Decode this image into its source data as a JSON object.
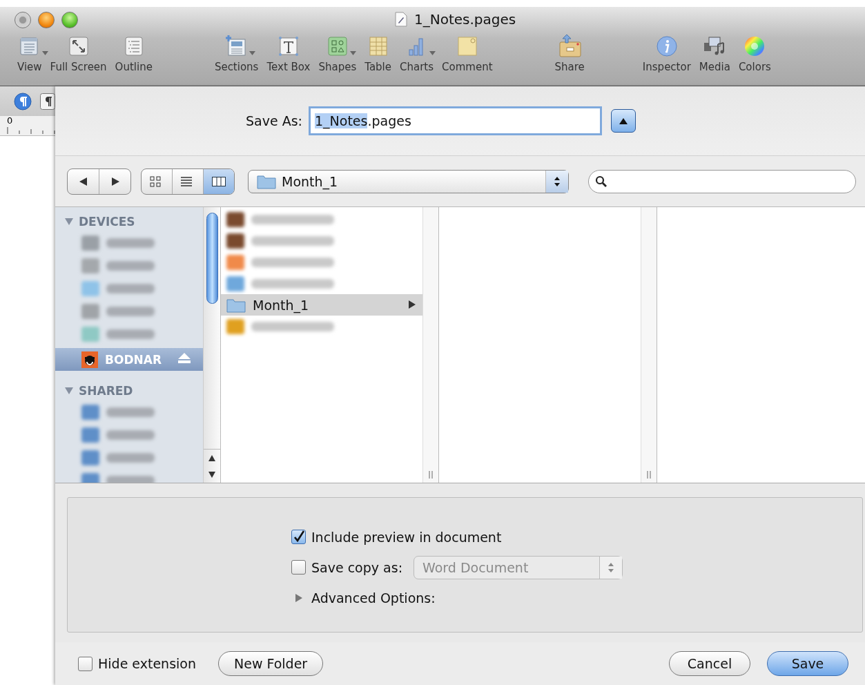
{
  "window": {
    "title": "1_Notes.pages"
  },
  "toolbar": {
    "groups": [
      {
        "items": [
          {
            "kind": "view",
            "label": "View",
            "has_menu": true
          },
          {
            "kind": "fullscreen",
            "label": "Full Screen",
            "has_menu": false
          },
          {
            "kind": "outline",
            "label": "Outline",
            "has_menu": false
          }
        ]
      },
      {
        "items": [
          {
            "kind": "sections",
            "label": "Sections",
            "has_menu": true
          },
          {
            "kind": "textbox",
            "label": "Text Box",
            "has_menu": false
          },
          {
            "kind": "shapes",
            "label": "Shapes",
            "has_menu": true
          },
          {
            "kind": "table",
            "label": "Table",
            "has_menu": false
          },
          {
            "kind": "charts",
            "label": "Charts",
            "has_menu": true
          },
          {
            "kind": "comment",
            "label": "Comment",
            "has_menu": false
          }
        ]
      },
      {
        "items": [
          {
            "kind": "share",
            "label": "Share",
            "has_menu": false
          }
        ]
      },
      {
        "items": [
          {
            "kind": "inspector",
            "label": "Inspector",
            "has_menu": false
          },
          {
            "kind": "media",
            "label": "Media",
            "has_menu": false
          },
          {
            "kind": "colors",
            "label": "Colors",
            "has_menu": false
          }
        ]
      }
    ]
  },
  "ruler": {
    "label": "0"
  },
  "save_dialog": {
    "save_as": {
      "label": "Save As:",
      "value_parts": [
        {
          "text": "1_Notes",
          "selected": true
        },
        {
          "text": ".pages",
          "selected": false
        }
      ],
      "expanded": true
    },
    "view_modes": [
      {
        "kind": "icons",
        "selected": false
      },
      {
        "kind": "list",
        "selected": false
      },
      {
        "kind": "columns",
        "selected": true
      }
    ],
    "location": {
      "value": "Month_1"
    },
    "sidebar": {
      "sections": [
        {
          "title": "DEVICES",
          "expanded": true,
          "items": [
            {
              "kind": "blurred",
              "color": "#9aa0a6"
            },
            {
              "kind": "blurred",
              "color": "#a4a8ac"
            },
            {
              "kind": "blurred",
              "color": "#8fc3e8"
            },
            {
              "kind": "blurred",
              "color": "#a0a4a8"
            },
            {
              "kind": "blurred",
              "color": "#8fc9c4"
            },
            {
              "kind": "volume",
              "label": "BODNAR",
              "selected": true,
              "ejectable": true
            }
          ]
        },
        {
          "title": "SHARED",
          "expanded": true,
          "items": [
            {
              "kind": "blurred",
              "color": "#5f8fc8"
            },
            {
              "kind": "blurred",
              "color": "#5f8fc8"
            },
            {
              "kind": "blurred",
              "color": "#5f8fc8"
            },
            {
              "kind": "blurred",
              "color": "#5f8fc8"
            }
          ]
        }
      ]
    },
    "columns": [
      {
        "items": [
          {
            "kind": "blurred",
            "color": "#7a4a2e"
          },
          {
            "kind": "blurred",
            "color": "#7a4a2e"
          },
          {
            "kind": "blurred",
            "color": "#f08a4a"
          },
          {
            "kind": "blurred",
            "color": "#6fa8dc"
          },
          {
            "kind": "folder",
            "label": "Month_1",
            "selected": true
          },
          {
            "kind": "blurred",
            "color": "#e0a020"
          }
        ]
      },
      {},
      {}
    ],
    "options": [
      {
        "kind": "checkbox",
        "label": "Include preview in document",
        "checked": true
      },
      {
        "kind": "checkbox_popup",
        "label": "Save copy as:",
        "checked": false,
        "popup": {
          "value": "Word Document",
          "disabled": true
        }
      },
      {
        "kind": "disclosure",
        "label": "Advanced Options:",
        "expanded": false
      }
    ],
    "hide_extension": {
      "label": "Hide extension",
      "checked": false
    },
    "buttons": [
      {
        "kind": "left",
        "label": "New Folder",
        "default": false
      },
      {
        "kind": "right",
        "label": "Cancel",
        "default": false
      },
      {
        "kind": "right",
        "label": "Save",
        "default": true
      }
    ]
  }
}
